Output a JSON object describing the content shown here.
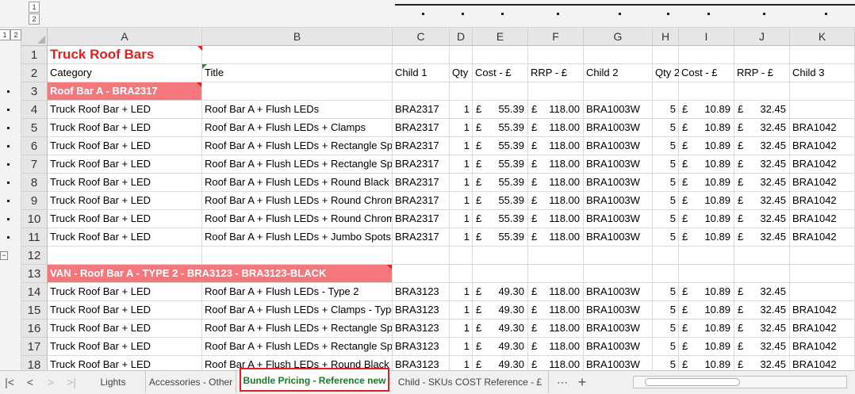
{
  "outline": {
    "levels": [
      "1",
      "2"
    ],
    "collapse_symbol": "−"
  },
  "columns": [
    "A",
    "B",
    "C",
    "D",
    "E",
    "F",
    "G",
    "H",
    "I",
    "J",
    "K"
  ],
  "row_numbers": [
    "1",
    "2",
    "3",
    "4",
    "5",
    "6",
    "7",
    "8",
    "9",
    "10",
    "11",
    "12",
    "13",
    "14",
    "15",
    "16",
    "17",
    "18"
  ],
  "sheet": {
    "title": "Truck Roof Bars",
    "headers": [
      "Category",
      "Title",
      "Child 1",
      "Qty",
      "Cost - £",
      "RRP - £",
      "Child 2",
      "Qty 2",
      "Cost - £",
      "RRP - £",
      "Child 3"
    ],
    "section_1": "Roof Bar A - BRA2317",
    "section_2": "VAN - Roof Bar A - TYPE 2 - BRA3123 - BRA3123-BLACK",
    "currency_symbol": "£",
    "rows_a": [
      {
        "category": "Truck Roof Bar + LED",
        "title": "Roof Bar A + Flush LEDs",
        "child1": "BRA2317",
        "qty": "1",
        "cost": "55.39",
        "rrp": "118.00",
        "child2": "BRA1003W",
        "qty2": "5",
        "cost2": "10.89",
        "rrp2": "32.45",
        "child3": ""
      },
      {
        "category": "Truck Roof Bar + LED",
        "title": "Roof Bar A + Flush LEDs + Clamps",
        "child1": "BRA2317",
        "qty": "1",
        "cost": "55.39",
        "rrp": "118.00",
        "child2": "BRA1003W",
        "qty2": "5",
        "cost2": "10.89",
        "rrp2": "32.45",
        "child3": "BRA1042"
      },
      {
        "category": "Truck Roof Bar + LED",
        "title": "Roof Bar A + Flush LEDs + Rectangle Spo",
        "child1": "BRA2317",
        "qty": "1",
        "cost": "55.39",
        "rrp": "118.00",
        "child2": "BRA1003W",
        "qty2": "5",
        "cost2": "10.89",
        "rrp2": "32.45",
        "child3": "BRA1042"
      },
      {
        "category": "Truck Roof Bar + LED",
        "title": "Roof Bar A + Flush LEDs + Rectangle Spo",
        "child1": "BRA2317",
        "qty": "1",
        "cost": "55.39",
        "rrp": "118.00",
        "child2": "BRA1003W",
        "qty2": "5",
        "cost2": "10.89",
        "rrp2": "32.45",
        "child3": "BRA1042"
      },
      {
        "category": "Truck Roof Bar + LED",
        "title": "Roof Bar A + Flush LEDs + Round Black S",
        "child1": "BRA2317",
        "qty": "1",
        "cost": "55.39",
        "rrp": "118.00",
        "child2": "BRA1003W",
        "qty2": "5",
        "cost2": "10.89",
        "rrp2": "32.45",
        "child3": "BRA1042"
      },
      {
        "category": "Truck Roof Bar + LED",
        "title": "Roof Bar A + Flush LEDs + Round Chrom",
        "child1": "BRA2317",
        "qty": "1",
        "cost": "55.39",
        "rrp": "118.00",
        "child2": "BRA1003W",
        "qty2": "5",
        "cost2": "10.89",
        "rrp2": "32.45",
        "child3": "BRA1042"
      },
      {
        "category": "Truck Roof Bar + LED",
        "title": "Roof Bar A + Flush LEDs + Round Chrom",
        "child1": "BRA2317",
        "qty": "1",
        "cost": "55.39",
        "rrp": "118.00",
        "child2": "BRA1003W",
        "qty2": "5",
        "cost2": "10.89",
        "rrp2": "32.45",
        "child3": "BRA1042"
      },
      {
        "category": "Truck Roof Bar + LED",
        "title": "Roof Bar A + Flush LEDs + Jumbo Spots",
        "child1": "BRA2317",
        "qty": "1",
        "cost": "55.39",
        "rrp": "118.00",
        "child2": "BRA1003W",
        "qty2": "5",
        "cost2": "10.89",
        "rrp2": "32.45",
        "child3": "BRA1042"
      }
    ],
    "rows_b": [
      {
        "category": "Truck Roof Bar + LED",
        "title": "Roof Bar A + Flush LEDs - Type 2",
        "child1": "BRA3123",
        "qty": "1",
        "cost": "49.30",
        "rrp": "118.00",
        "child2": "BRA1003W",
        "qty2": "5",
        "cost2": "10.89",
        "rrp2": "32.45",
        "child3": ""
      },
      {
        "category": "Truck Roof Bar + LED",
        "title": "Roof Bar A + Flush LEDs + Clamps - Type",
        "child1": "BRA3123",
        "qty": "1",
        "cost": "49.30",
        "rrp": "118.00",
        "child2": "BRA1003W",
        "qty2": "5",
        "cost2": "10.89",
        "rrp2": "32.45",
        "child3": "BRA1042"
      },
      {
        "category": "Truck Roof Bar + LED",
        "title": "Roof Bar A + Flush LEDs + Rectangle Spo",
        "child1": "BRA3123",
        "qty": "1",
        "cost": "49.30",
        "rrp": "118.00",
        "child2": "BRA1003W",
        "qty2": "5",
        "cost2": "10.89",
        "rrp2": "32.45",
        "child3": "BRA1042"
      },
      {
        "category": "Truck Roof Bar + LED",
        "title": "Roof Bar A + Flush LEDs + Rectangle Spo",
        "child1": "BRA3123",
        "qty": "1",
        "cost": "49.30",
        "rrp": "118.00",
        "child2": "BRA1003W",
        "qty2": "5",
        "cost2": "10.89",
        "rrp2": "32.45",
        "child3": "BRA1042"
      },
      {
        "category": "Truck Roof Bar + LED",
        "title": "Roof Bar A + Flush LEDs + Round Black S",
        "child1": "BRA3123",
        "qty": "1",
        "cost": "49.30",
        "rrp": "118.00",
        "child2": "BRA1003W",
        "qty2": "5",
        "cost2": "10.89",
        "rrp2": "32.45",
        "child3": "BRA1042"
      }
    ]
  },
  "tabs": {
    "nav": {
      "first": "|<",
      "prev": "<",
      "next": ">",
      "last": ">|"
    },
    "items": [
      {
        "label": "Lights",
        "active": false
      },
      {
        "label": "Accessories - Other",
        "active": false
      },
      {
        "label": "Bundle Pricing - Reference new",
        "active": true
      },
      {
        "label": "Child - SKUs COST Reference - £",
        "active": false
      }
    ],
    "more": "⋯",
    "add": "+"
  },
  "colors": {
    "title_red": "#e0211b",
    "section_fill": "#f4777c",
    "active_tab_text": "#1c7a2c",
    "active_tab_border": "#e02020"
  }
}
